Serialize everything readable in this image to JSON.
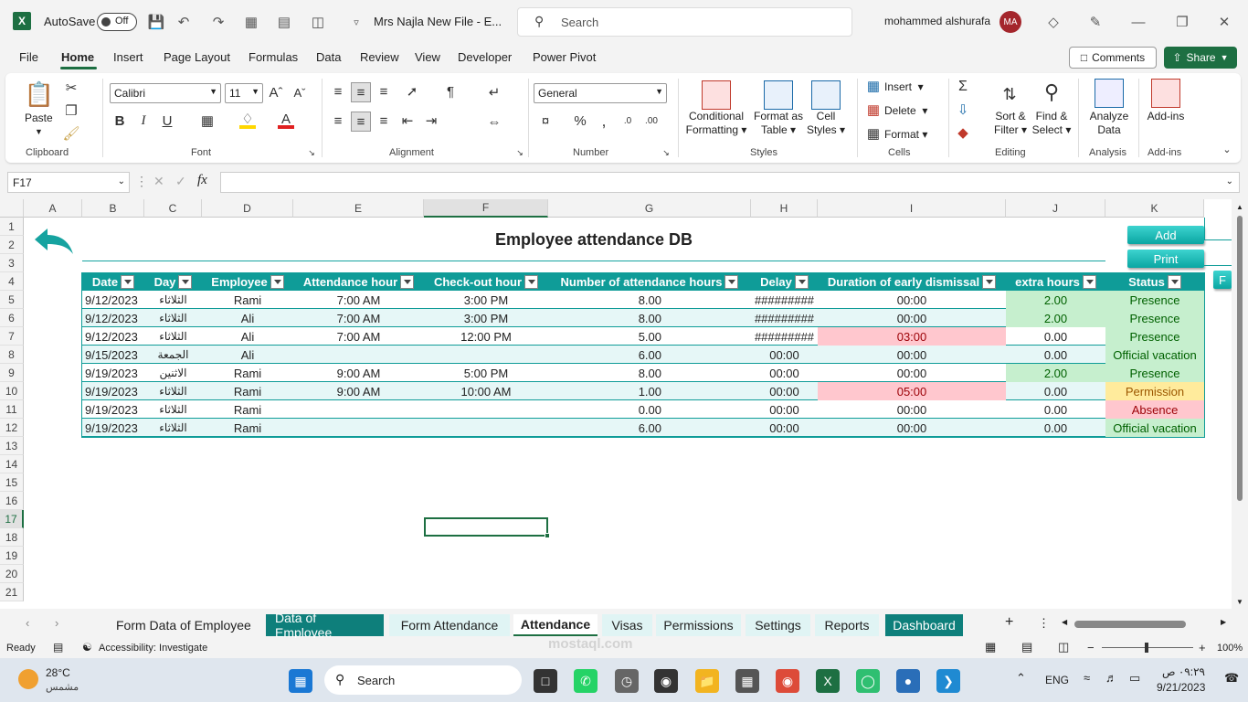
{
  "titlebar": {
    "autosave_label": "AutoSave",
    "autosave_state": "Off",
    "file_name": "Mrs Najla New File  -  E...",
    "search_placeholder": "Search",
    "user_name": "mohammed alshurafa",
    "user_initials": "MA"
  },
  "menu": {
    "items": [
      "File",
      "Home",
      "Insert",
      "Page Layout",
      "Formulas",
      "Data",
      "Review",
      "View",
      "Developer",
      "Power Pivot"
    ],
    "comments_label": "Comments",
    "share_label": "Share"
  },
  "ribbon": {
    "paste_label": "Paste",
    "clipboard_label": "Clipboard",
    "font_name": "Calibri",
    "font_size": "11",
    "font_label": "Font",
    "alignment_label": "Alignment",
    "number_format": "General",
    "number_label": "Number",
    "conditional_formatting": [
      "Conditional",
      "Formatting"
    ],
    "format_as_table": [
      "Format as",
      "Table"
    ],
    "cell_styles": [
      "Cell",
      "Styles"
    ],
    "styles_label": "Styles",
    "insert_label": "Insert",
    "delete_label": "Delete",
    "format_label": "Format",
    "cells_label": "Cells",
    "sort_filter": [
      "Sort &",
      "Filter"
    ],
    "find_select": [
      "Find &",
      "Select"
    ],
    "editing_label": "Editing",
    "analyze_data": [
      "Analyze",
      "Data"
    ],
    "analysis_label": "Analysis",
    "addins": "Add-ins",
    "addins_label": "Add-ins"
  },
  "formula_bar": {
    "name_box": "F17",
    "fx": "fx",
    "content": ""
  },
  "columns": [
    "A",
    "B",
    "C",
    "D",
    "E",
    "F",
    "G",
    "H",
    "I",
    "J",
    "K"
  ],
  "rows": [
    "1",
    "2",
    "3",
    "4",
    "5",
    "6",
    "7",
    "8",
    "9",
    "10",
    "11",
    "12",
    "13",
    "14",
    "15",
    "16",
    "17",
    "18",
    "19",
    "20",
    "21"
  ],
  "sheet": {
    "title": "Employee attendance DB",
    "add_button": "Add",
    "print_button": "Print",
    "side_button": "F",
    "headers": [
      "Date",
      "Day",
      "Employee",
      "Attendance hour",
      "Check-out hour",
      "Number of attendance hours",
      "Delay",
      "Duration of early dismissal",
      "extra hours",
      "Status"
    ],
    "records": [
      [
        "9/12/2023",
        "الثلاثاء",
        "Rami",
        "7:00 AM",
        "3:00 PM",
        "8.00",
        "#########",
        "00:00",
        "2.00",
        "Presence"
      ],
      [
        "9/12/2023",
        "الثلاثاء",
        "Ali",
        "7:00 AM",
        "3:00 PM",
        "8.00",
        "#########",
        "00:00",
        "2.00",
        "Presence"
      ],
      [
        "9/12/2023",
        "الثلاثاء",
        "Ali",
        "7:00 AM",
        "12:00 PM",
        "5.00",
        "#########",
        "03:00",
        "0.00",
        "Presence"
      ],
      [
        "9/15/2023",
        "الجمعة",
        "Ali",
        "",
        "",
        "6.00",
        "00:00",
        "00:00",
        "0.00",
        "Official vacation"
      ],
      [
        "9/19/2023",
        "الاثنين",
        "Rami",
        "9:00 AM",
        "5:00 PM",
        "8.00",
        "00:00",
        "00:00",
        "2.00",
        "Presence"
      ],
      [
        "9/19/2023",
        "الثلاثاء",
        "Rami",
        "9:00 AM",
        "10:00 AM",
        "1.00",
        "00:00",
        "05:00",
        "0.00",
        "Permission"
      ],
      [
        "9/19/2023",
        "الثلاثاء",
        "Rami",
        "",
        "",
        "0.00",
        "00:00",
        "00:00",
        "0.00",
        "Absence"
      ],
      [
        "9/19/2023",
        "الثلاثاء",
        "Rami",
        "",
        "",
        "6.00",
        "00:00",
        "00:00",
        "0.00",
        "Official vacation"
      ]
    ],
    "colors": {
      "header": "#0f9c98",
      "presence": "#c6efce",
      "presence_text": "#006100",
      "absence": "#ffc7ce",
      "absence_text": "#9c0006",
      "permission": "#ffeb9c",
      "permission_text": "#9c5700",
      "alt_row": "#e6f7f7"
    }
  },
  "sheet_tabs": [
    "Form Data of Employee",
    "Data of Employee",
    "Form Attendance",
    "Attendance",
    "Visas",
    "Permissions",
    "Settings",
    "Reports",
    "Dashboard"
  ],
  "statusbar": {
    "ready": "Ready",
    "accessibility": "Accessibility: Investigate",
    "zoom": "100%"
  },
  "taskbar": {
    "temp": "28°C",
    "weather": "مشمس",
    "search": "Search",
    "lang": "ENG",
    "time": "٠٩:٢٩ ص",
    "date": "9/21/2023"
  },
  "watermark": "mostaql.com"
}
